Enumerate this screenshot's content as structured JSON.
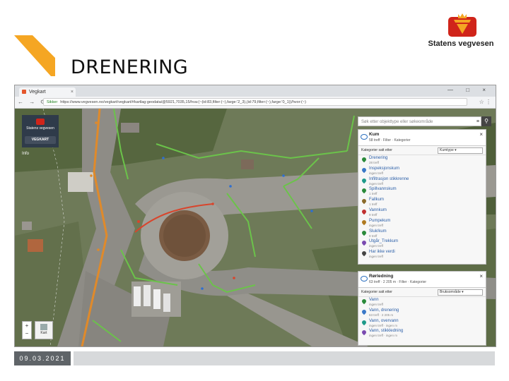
{
  "slide": {
    "title": "DRENERING",
    "date": "09.03.2021",
    "org_name": "Statens vegvesen"
  },
  "browser": {
    "tab_title": "Vegkart",
    "tab_close": "×",
    "window_controls": "— □ ×",
    "nav_icons": "← → ⟳",
    "url_secure": "Sikker",
    "url": "https://www.vegvesen.no/vegkart/vegkart/#kartlag:geodata/@5921,7035,15/hva:(~(id:83,filter:(~),farge:'2_3),(id:79,filter:(~),farge:'0_1))/hvor:(~)",
    "addr_right": "☆ ⋮"
  },
  "map_ui": {
    "brand_label": "Statens vegvesen",
    "brand_button": "VEGKART",
    "info_label": "Info",
    "zoom_in": "+",
    "zoom_out": "−",
    "kart_label": "Kart",
    "search_placeholder": "Søk etter objekttype eller søkeområde",
    "search_actions": "≡",
    "search_icon": "⚲"
  },
  "panels": [
    {
      "name": "Kum",
      "subtitle": "58 treff · Filter · Kategorier",
      "close": "×",
      "category_row": "Kategorier satt etter",
      "category_select": "Kumtype ▾",
      "items": [
        {
          "label": "Drenering",
          "count": "28 treff",
          "color": "#2a8a3a"
        },
        {
          "label": "Inspeksjonskum",
          "count": "ingen treff",
          "color": "#3a78c8"
        },
        {
          "label": "Infiltrasjon stikkrenne",
          "count": "ingen treff",
          "color": "#1e9a8a"
        },
        {
          "label": "Spillvannskum",
          "count": "1 treff",
          "color": "#2a8a3a"
        },
        {
          "label": "Fallkum",
          "count": "1 treff",
          "color": "#8a6a2a"
        },
        {
          "label": "Vannkum",
          "count": "9 treff",
          "color": "#c03030"
        },
        {
          "label": "Pumpekum",
          "count": "ingen treff",
          "color": "#b07a20"
        },
        {
          "label": "Sluk/kum",
          "count": "9 treff",
          "color": "#2a8a3a"
        },
        {
          "label": "Utgår_Trekkum",
          "count": "ingen treff",
          "color": "#7a4ab0"
        },
        {
          "label": "Har ikke verdi",
          "count": "ingen treff",
          "color": "#444444"
        }
      ]
    },
    {
      "name": "Rørledning",
      "subtitle": "63 treff · 2 205 m · Filter · Kategorier",
      "close": "×",
      "category_row": "Kategorier satt etter",
      "category_select": "Bruksområde ▾",
      "items": [
        {
          "label": "Vann",
          "count": "ingen treff",
          "color": "#2a8a3a"
        },
        {
          "label": "Vann, drenering",
          "count": "63 treff · 2 205 m",
          "color": "#3a78c8"
        },
        {
          "label": "Vann, overvann",
          "count": "ingen treff · ingen m",
          "color": "#1e9a8a"
        },
        {
          "label": "Vann, stikkledning",
          "count": "ingen treff · ingen m",
          "color": "#7a4ab0"
        }
      ]
    }
  ]
}
